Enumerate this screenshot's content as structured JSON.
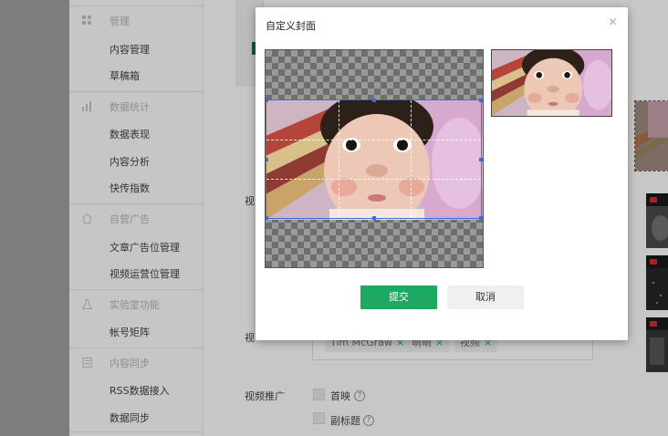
{
  "sidebar": {
    "sections": [
      {
        "title": "管理",
        "icon": "grid-icon",
        "items": [
          "内容管理",
          "草稿箱"
        ]
      },
      {
        "title": "数据统计",
        "icon": "bar-chart-icon",
        "items": [
          "数据表现",
          "内容分析",
          "快传指数"
        ]
      },
      {
        "title": "自营广告",
        "icon": "house-icon",
        "items": [
          "文章广告位管理",
          "视频运营位管理"
        ]
      },
      {
        "title": "实验室功能",
        "icon": "flask-icon",
        "items": [
          "帐号矩阵"
        ]
      },
      {
        "title": "内容同步",
        "icon": "document-icon",
        "items": [
          "RSS数据接入",
          "数据同步"
        ]
      }
    ]
  },
  "form": {
    "label_video_1": "视",
    "label_video_2": "视",
    "tags": [
      "Tim McGraw",
      "萌萌",
      "视频"
    ],
    "promo_label": "视频推广",
    "option_first": "首映",
    "option_subtitle": "副标题",
    "help_glyph": "?"
  },
  "modal": {
    "title": "自定义封面",
    "close_glyph": "×",
    "submit_label": "提交",
    "cancel_label": "取消"
  },
  "colors": {
    "primary_green": "#1fa863",
    "crop_border_blue": "#3a6fd8"
  }
}
